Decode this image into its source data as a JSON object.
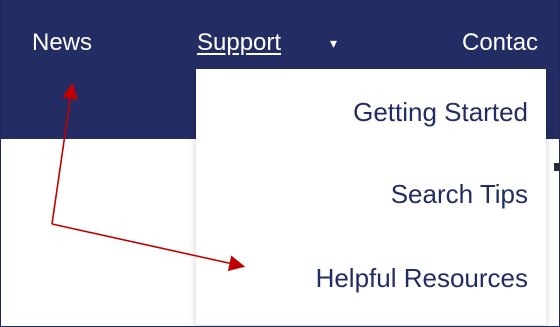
{
  "nav": {
    "news": "News",
    "support": "Support",
    "contact": "Contac",
    "caret_icon": "chevron-down-icon"
  },
  "dropdown": {
    "items": [
      {
        "label": "Getting Started"
      },
      {
        "label": "Search Tips"
      },
      {
        "label": "Helpful Resources"
      }
    ]
  },
  "colors": {
    "nav_background": "#232d63",
    "nav_text": "#ffffff",
    "dropdown_text": "#232d63",
    "annotation_arrow": "#c00000"
  }
}
